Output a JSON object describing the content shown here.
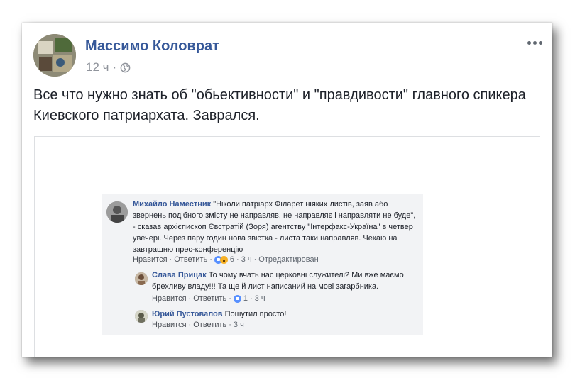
{
  "post": {
    "author": "Массимо Коловрат",
    "time": "12 ч",
    "separator": "·",
    "privacy_icon": "globe-icon",
    "more_icon": "more-horizontal-icon",
    "text": "Все что нужно знать об \"обьективности\" и \"правдивости\" главного спикера Киевского патриархата. Заврался."
  },
  "screenshot": {
    "comments": [
      {
        "author": "Михайло Наместник",
        "text": "\"Ніколи патріарх Філарет ніяких листів, заяв або звернень подібного змісту не направляв, не направляє і направляти не буде\", - сказав архієпископ Євстратій (Зоря) агентству \"Інтерфакс-Україна\" в четвер увечері. Через пару годин нова звістка - листа таки направляв. Чекаю на завтрашню прес-конференцію",
        "like": "Нравится",
        "reply": "Ответить",
        "reactions_count": "6",
        "time": "3 ч",
        "edited": "Отредактирован",
        "dot": "·"
      },
      {
        "author": "Слава Прицак",
        "text": "То чому вчать нас церковні служителі? Ми вже маємо брехливу владу!!! Та ще й лист написаний на мові загарбника.",
        "like": "Нравится",
        "reply": "Ответить",
        "reactions_count": "1",
        "time": "3 ч",
        "dot": "·"
      },
      {
        "author": "Юрий Пустовалов",
        "text": "Пошутил просто!",
        "like": "Нравится",
        "reply": "Ответить",
        "time": "3 ч",
        "dot": "·"
      }
    ]
  },
  "colors": {
    "link": "#365899",
    "text": "#1d2129",
    "meta": "#90949c"
  }
}
